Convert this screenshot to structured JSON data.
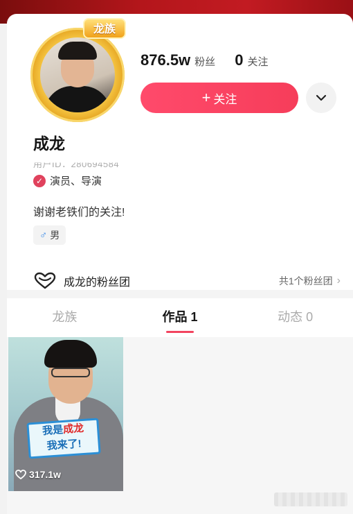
{
  "profile": {
    "avatar_badge": "龙族",
    "name": "成龙",
    "user_id": "用户ID：280694584",
    "verification": "演员、导演",
    "bio": "谢谢老铁们的关注!",
    "gender": "男"
  },
  "stats": {
    "followers_value": "876.5w",
    "followers_label": "粉丝",
    "following_value": "0",
    "following_label": "关注"
  },
  "actions": {
    "follow_label": "关注",
    "more_icon": "chevron-down-icon"
  },
  "fan_club": {
    "label": "成龙的粉丝团",
    "count_text": "共1个粉丝团"
  },
  "tabs": [
    {
      "label": "龙族"
    },
    {
      "label": "作品 1"
    },
    {
      "label": "动态 0"
    }
  ],
  "videos": [
    {
      "caption_line1_a": "我是",
      "caption_line1_b": "成龙",
      "caption_line2": "我来了!",
      "likes": "317.1w"
    }
  ],
  "colors": {
    "accent": "#f63d5a",
    "banner": "#b4161b",
    "badge_gold": "#f1a21b"
  }
}
